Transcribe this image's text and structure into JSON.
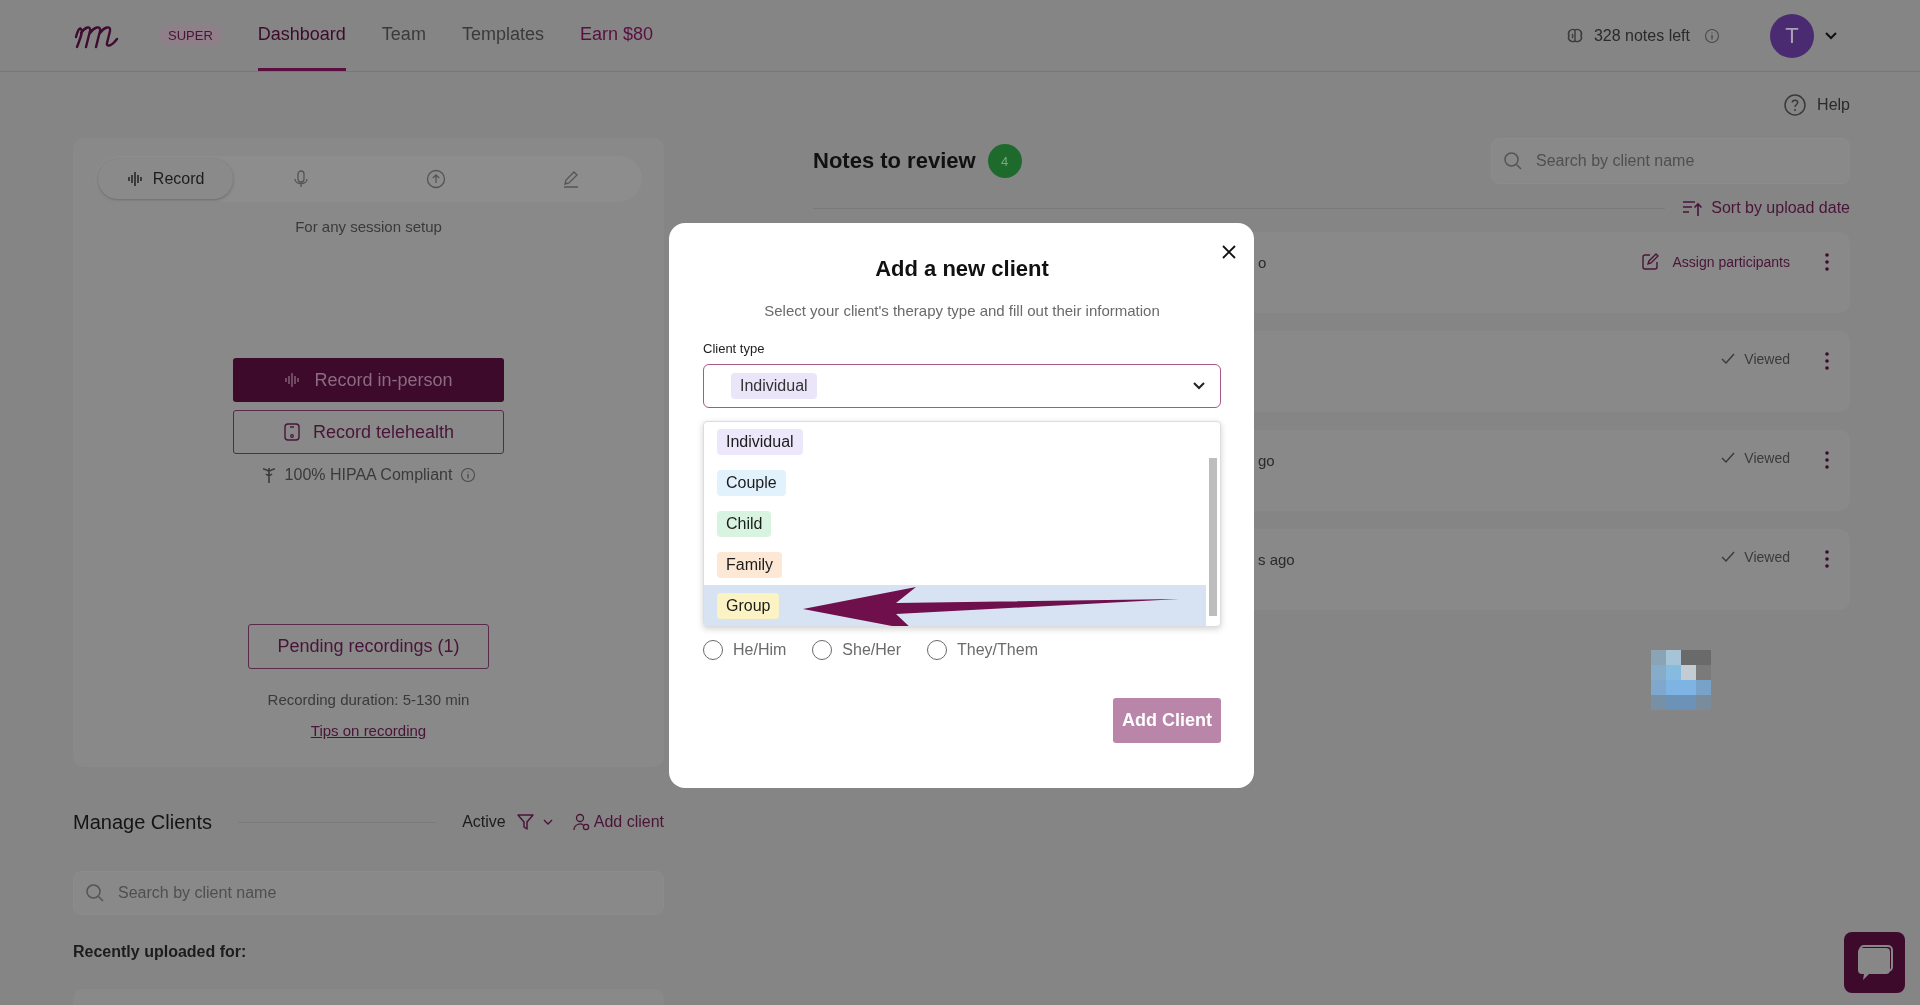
{
  "header": {
    "badge": "SUPER",
    "tabs": [
      {
        "label": "Dashboard",
        "selected": true,
        "kind": "nav"
      },
      {
        "label": "Team",
        "selected": false,
        "kind": "nav"
      },
      {
        "label": "Templates",
        "selected": false,
        "kind": "nav"
      },
      {
        "label": "Earn $80",
        "selected": false,
        "kind": "promo"
      }
    ],
    "notes_left": "328 notes left",
    "avatar": "T"
  },
  "help": "Help",
  "recorder": {
    "modes": [
      {
        "label": "Record",
        "selected": true,
        "kind": "record"
      },
      {
        "selected": false,
        "kind": "mic"
      },
      {
        "selected": false,
        "kind": "upload"
      },
      {
        "selected": false,
        "kind": "write"
      }
    ],
    "caption": "For any session setup",
    "primary": "Record in-person",
    "secondary": "Record telehealth",
    "compliance": "100% HIPAA Compliant",
    "pending": "Pending recordings (1)",
    "duration": "Recording duration: 5-130 min",
    "tips": "Tips on recording"
  },
  "manage_clients": {
    "title": "Manage Clients",
    "filter": "Active",
    "add": "Add client",
    "search": {
      "placeholder": "Search by client name"
    },
    "recent_label": "Recently uploaded for:"
  },
  "notes": {
    "title": "Notes to review",
    "count": "4",
    "search": {
      "placeholder": "Search by client name"
    },
    "sort": "Sort by upload date",
    "items": [
      {
        "text": "o",
        "status": "Assign participants",
        "kind": "assign"
      },
      {
        "status": "Viewed",
        "kind": "viewed"
      },
      {
        "text": "go",
        "status": "Viewed",
        "kind": "viewed"
      },
      {
        "text": "s ago",
        "status": "Viewed",
        "kind": "viewed"
      }
    ]
  },
  "modal": {
    "title": "Add a new client",
    "subtitle": "Select your client's therapy type and fill out their information",
    "client_type": {
      "label": "Client type",
      "value": "Individual",
      "color": "#ebe5fa"
    },
    "options": [
      {
        "label": "Individual",
        "color": "#ede7fb",
        "selected": false
      },
      {
        "label": "Couple",
        "color": "#e2f2fc",
        "selected": false
      },
      {
        "label": "Child",
        "color": "#d9f3e1",
        "selected": false
      },
      {
        "label": "Family",
        "color": "#fde8d6",
        "selected": false
      },
      {
        "label": "Group",
        "color": "#fcf3c4",
        "selected": true
      }
    ],
    "pronouns": [
      {
        "label": "He/Him",
        "selected": false
      },
      {
        "label": "She/Her",
        "selected": false
      },
      {
        "label": "They/Them",
        "selected": false
      }
    ],
    "submit": "Add Client"
  }
}
